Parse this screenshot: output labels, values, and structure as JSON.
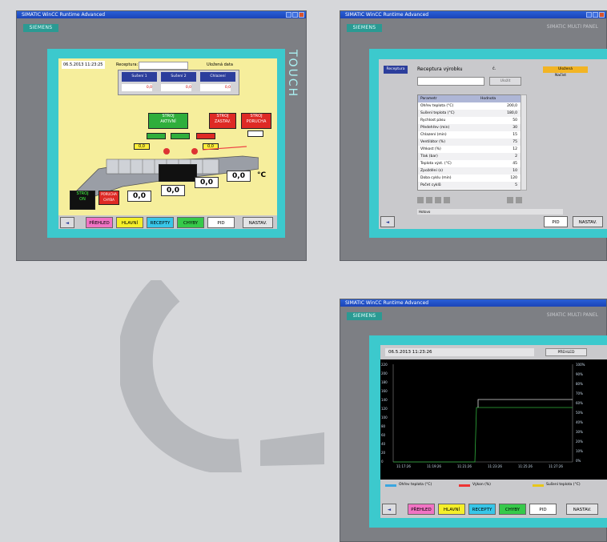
{
  "panel_common": {
    "window_title": "SIMATIC WinCC Runtime Advanced",
    "brand": "SIEMENS",
    "model": "SIMATIC MULTI PANEL",
    "touch_label": "TOUCH"
  },
  "nav_buttons": {
    "back": "◄",
    "prehled": "PŘEHLED",
    "hlavni": "HLAVNÍ",
    "recepty": "RECEPTY",
    "chyby": "CHYBY",
    "pid": "PID",
    "nastav": "NASTAV."
  },
  "screen1": {
    "datetime": "06.5.2013 11:23:25",
    "recipe_label": "Receptura:",
    "status": "Uložená data",
    "tabs": [
      "Sušení 1",
      "Sušení 2",
      "Chlazení"
    ],
    "tab_values": [
      "0,0",
      "0,0",
      "0,0"
    ],
    "boxes": {
      "g1": "STROJ\nAKTIVNÍ",
      "r1": "STROJ\nZASTAV.",
      "r2": "STROJ\nPORUCHA",
      "y1": "0,0",
      "y2": "0,0"
    },
    "run_label": "STROJ\nON",
    "small_red": "PORUCHA\nCHYBA",
    "temps": [
      "0,0",
      "0,0",
      "0,0",
      "0,0"
    ],
    "unit": "°C"
  },
  "screen2": {
    "side_tab": "Receptura",
    "title": "Receptura výrobku",
    "field_label": "č.",
    "field_value": "",
    "btn_gray": "Uložit",
    "btn_yellow": "Uložená",
    "btn_yellow_sub": "Načíst",
    "table_headers": [
      "Parametr",
      "Hodnota"
    ],
    "table_rows": [
      [
        "Ohřev teplota (°C)",
        "200,0"
      ],
      [
        "Sušení teplota (°C)",
        "180,0"
      ],
      [
        "Rychlost pásu",
        "50"
      ],
      [
        "Předehřev (min)",
        "30"
      ],
      [
        "Chlazení (min)",
        "15"
      ],
      [
        "Ventilátor (%)",
        "75"
      ],
      [
        "Vlhkost (%)",
        "12"
      ],
      [
        "Tlak (bar)",
        "2"
      ],
      [
        "Teplota výst. (°C)",
        "45"
      ],
      [
        "Zpoždění (s)",
        "10"
      ],
      [
        "Doba cyklu (min)",
        "120"
      ],
      [
        "Počet cyklů",
        "5"
      ]
    ],
    "status_bar": "Hotovo"
  },
  "screen3": {
    "datetime": "06.5.2013 11:23:26",
    "top_button": "PŘEHLED",
    "y_left": [
      "220",
      "200",
      "180",
      "160",
      "140",
      "120",
      "100",
      "80",
      "60",
      "40",
      "20",
      "0"
    ],
    "y_right": [
      "100%",
      "90%",
      "80%",
      "70%",
      "60%",
      "50%",
      "40%",
      "30%",
      "20%",
      "10%",
      "0%"
    ],
    "x_ticks": [
      "11:17:26",
      "11:19:26",
      "11:21:26",
      "11:23:26",
      "11:25:26",
      "11:27:26"
    ],
    "legend": [
      "Ohřev teplota (°C)",
      "Výkon (%)",
      "Sušení teplota (°C)"
    ],
    "legend_colors": [
      "#3aa6e0",
      "#e33",
      "#e8c619"
    ]
  },
  "colors": {
    "frame": "#3cc9cd",
    "screen_yellow": "#f6ee9c",
    "green": "#2fae3c",
    "red": "#de2a25",
    "panel_gray": "#7d7f84"
  }
}
